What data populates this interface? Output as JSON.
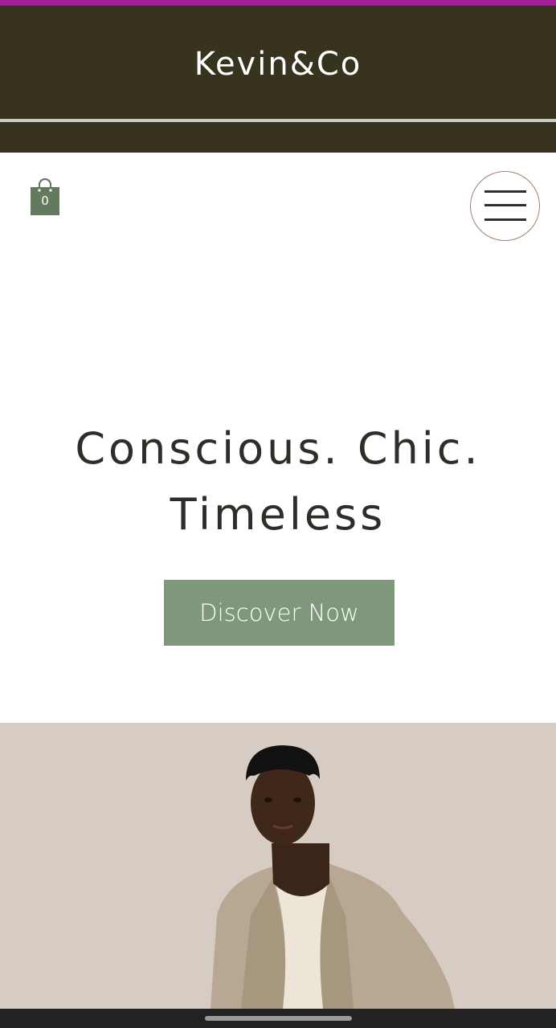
{
  "theme": {
    "accent_top": "#a31d9a",
    "header_background": "#37331f",
    "primary_green": "#7f977a",
    "menu_ring": "#a67f6c",
    "hero_background": "#d6ccc3"
  },
  "header": {
    "brand": "Kevin&Co"
  },
  "toolbar": {
    "cart_icon": "shopping-bag-icon",
    "cart_count": "0",
    "menu_icon": "hamburger-menu-icon"
  },
  "hero": {
    "heading_line1": "Conscious. Chic.",
    "heading_line2": "Timeless",
    "cta_label": "Discover Now",
    "image_subject": "model-in-beige-suit"
  }
}
